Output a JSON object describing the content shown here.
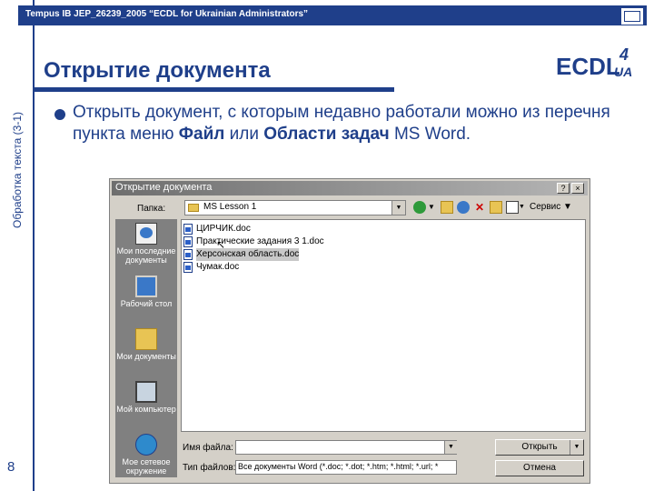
{
  "header": {
    "project_title": "Tempus IB JEP_26239_2005 “ECDL for Ukrainian Administrators”",
    "slide_title": "Открытие документа",
    "side_label": "Обработка текста (3-1)",
    "slide_number": "8",
    "logo_text": "ECDL",
    "logo_sup": "4",
    "logo_sub": "UA"
  },
  "bullet": {
    "part1": "Открыть документ, с которым недавно работали можно из перечня пункта меню ",
    "bold1": "Файл",
    "part2": " или ",
    "bold2": "Области задач",
    "part3": " MS Word."
  },
  "dialog": {
    "title": "Открытие документа",
    "help_button": "?",
    "close_button": "×",
    "look_in_label": "Папка:",
    "look_in_value": "MS Lesson 1",
    "tools_label": "Сервис",
    "places": [
      {
        "label": "Мои последние документы"
      },
      {
        "label": "Рабочий стол"
      },
      {
        "label": "Мои документы"
      },
      {
        "label": "Мой компьютер"
      },
      {
        "label": "Мое сетевое окружение"
      }
    ],
    "files": [
      {
        "name": "ЦИРЧИК.doc"
      },
      {
        "name": "Практические задания 3 1.doc"
      },
      {
        "name": "Херсонская область.doc"
      },
      {
        "name": "Чумак.doc"
      }
    ],
    "file_name_label": "Имя файла:",
    "file_name_value": "",
    "file_type_label": "Тип файлов:",
    "file_type_value": "Все документы Word (*.doc; *.dot; *.htm; *.html; *.url; *",
    "open_button": "Открыть",
    "cancel_button": "Отмена"
  }
}
